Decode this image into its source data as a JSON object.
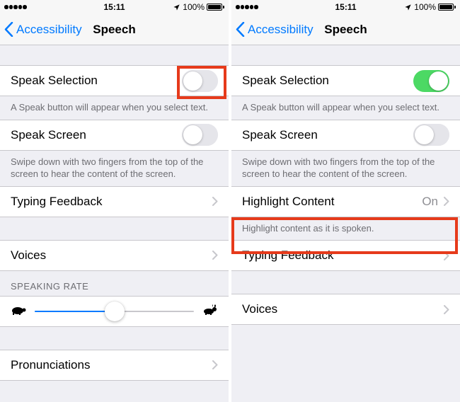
{
  "left": {
    "status": {
      "time": "15:11",
      "battery": "100%"
    },
    "nav": {
      "back": "Accessibility",
      "title": "Speech"
    },
    "speakSelection": {
      "label": "Speak Selection",
      "on": false,
      "footer": "A Speak button will appear when you select text."
    },
    "speakScreen": {
      "label": "Speak Screen",
      "on": false,
      "footer": "Swipe down with two fingers from the top of the screen to hear the content of the screen."
    },
    "typingFeedback": {
      "label": "Typing Feedback"
    },
    "voices": {
      "label": "Voices"
    },
    "speakingRate": {
      "header": "SPEAKING RATE",
      "value": 0.5
    },
    "pronunciations": {
      "label": "Pronunciations"
    }
  },
  "right": {
    "status": {
      "time": "15:11",
      "battery": "100%"
    },
    "nav": {
      "back": "Accessibility",
      "title": "Speech"
    },
    "speakSelection": {
      "label": "Speak Selection",
      "on": true,
      "footer": "A Speak button will appear when you select text."
    },
    "speakScreen": {
      "label": "Speak Screen",
      "on": false,
      "footer": "Swipe down with two fingers from the top of the screen to hear the content of the screen."
    },
    "highlightContent": {
      "label": "Highlight Content",
      "value": "On",
      "footer": "Highlight content as it is spoken."
    },
    "typingFeedback": {
      "label": "Typing Feedback"
    },
    "voices": {
      "label": "Voices"
    }
  }
}
